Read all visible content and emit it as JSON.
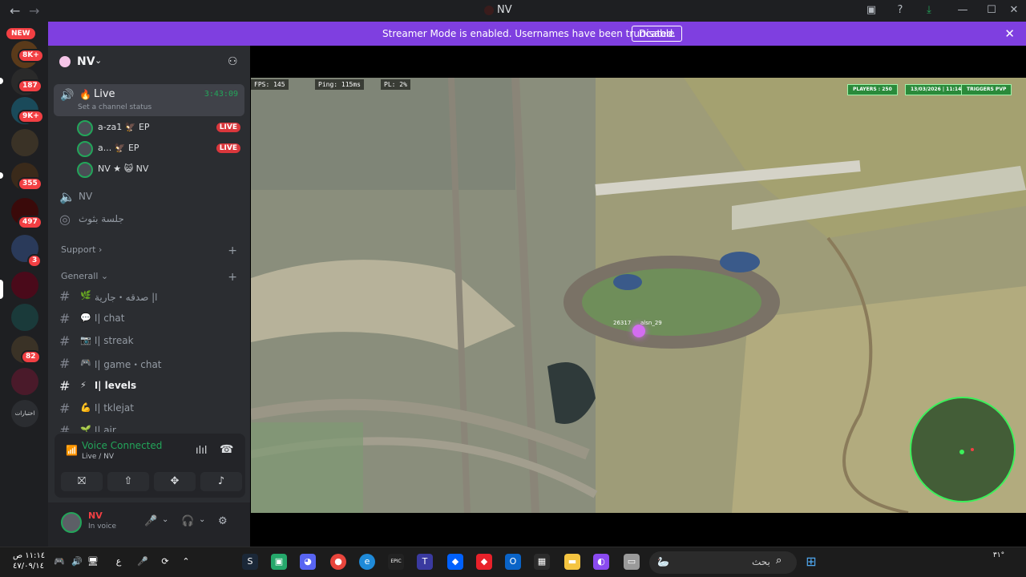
{
  "window": {
    "title": "NV"
  },
  "banner": {
    "message": "Streamer Mode is enabled. Usernames have been truncated.",
    "disable_label": "Disable"
  },
  "rail": {
    "new_label": "NEW",
    "badges": [
      "8K+",
      "187",
      "9K+",
      "355",
      "497",
      "3",
      "82"
    ],
    "last_server_label": "اختبارات"
  },
  "guild": {
    "name": "NV"
  },
  "voice_channel": {
    "name": "Live",
    "timer": "3:43:09",
    "status_prompt": "Set a channel status"
  },
  "voice_users": [
    {
      "name": "a-za1",
      "tag": "EP",
      "live": "LIVE"
    },
    {
      "name": "a...",
      "tag": "EP",
      "live": "LIVE"
    },
    {
      "name": "NV ★",
      "tag": "NV",
      "live": ""
    }
  ],
  "channels_top": [
    {
      "name": "NV"
    },
    {
      "name": "جلسة بثوث"
    }
  ],
  "categories": [
    {
      "name": "Support"
    },
    {
      "name": "Generall"
    }
  ],
  "text_channels": [
    {
      "name": "ا| صدقه・جارية",
      "icon": "🌿"
    },
    {
      "name": "ا| chat",
      "icon": "💬"
    },
    {
      "name": "ا| streak",
      "icon": "📷"
    },
    {
      "name": "ا| game・chat",
      "icon": "🎮"
    },
    {
      "name": "ا| levels",
      "icon": "⚡"
    },
    {
      "name": "ا| tklejat",
      "icon": "💪"
    },
    {
      "name": "ا| air",
      "icon": "🌱"
    }
  ],
  "voice_panel": {
    "status": "Voice Connected",
    "sub": "Live / NV"
  },
  "user": {
    "name": "NV",
    "status": "In voice"
  },
  "game_hud": {
    "fps": "FPS: 145",
    "ping": "Ping: 115ms",
    "pl": "PL: 2%",
    "players": "PLAYERS : 250",
    "date": "13/03/2026 | 11:14",
    "server": "TRIGGERS PVP",
    "player_tag_1": "26317",
    "player_tag_2": "alsn_29"
  },
  "taskbar": {
    "time": "١١:١٤ ص",
    "date": "٤٧/٠٩/١٤",
    "search_placeholder": "بحث",
    "lang": "ع",
    "temp": "٣١°"
  },
  "colors": {
    "accent": "#7f3fe0",
    "green": "#23a55a",
    "red": "#da373c",
    "sidebar": "#2b2d31"
  }
}
